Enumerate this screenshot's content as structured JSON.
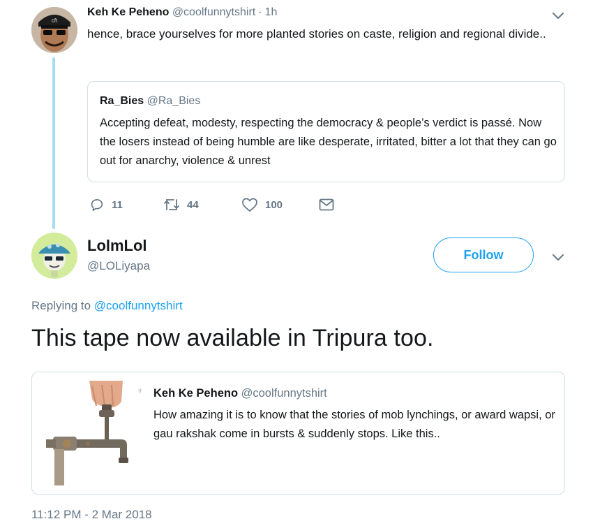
{
  "parent_tweet": {
    "author_name": "Keh Ke Peheno",
    "author_handle": "@coolfunnytshirt",
    "separator": "·",
    "time": "1h",
    "text": "hence, brace yourselves for more planted stories on caste, religion and regional divide..",
    "quoted": {
      "author_name": "Ra_Bies",
      "author_handle": "@Ra_Bies",
      "text": "Accepting defeat, modesty, respecting the democracy & people’s verdict is passé. Now the losers instead of being humble are like desperate, irritated, bitter a lot that they can go out for anarchy, violence & unrest"
    },
    "actions": {
      "reply_count": "11",
      "retweet_count": "44",
      "like_count": "100"
    }
  },
  "main_tweet": {
    "author_name": "LolmLol",
    "author_handle": "@LOLiyapa",
    "follow_label": "Follow",
    "replying_prefix": "Replying to",
    "replying_handle": "@coolfunnytshirt",
    "text": "This tape now available in Tripura too.",
    "quoted": {
      "author_name": "Keh Ke Peheno",
      "author_handle": "@coolfunnytshirt",
      "text": "How amazing it is to know that the stories of mob lynchings, or award wapsi, or gau rakshak come in bursts & suddenly stops. Like this.."
    },
    "timestamp": "11:12 PM - 2 Mar 2018"
  },
  "colors": {
    "accent": "#1da1f2",
    "thread_line": "#a7dbf7",
    "secondary_text": "#657786",
    "border": "#d4dde3"
  },
  "icons": [
    "chevron-down-icon",
    "reply-icon",
    "retweet-icon",
    "like-icon",
    "dm-icon"
  ]
}
